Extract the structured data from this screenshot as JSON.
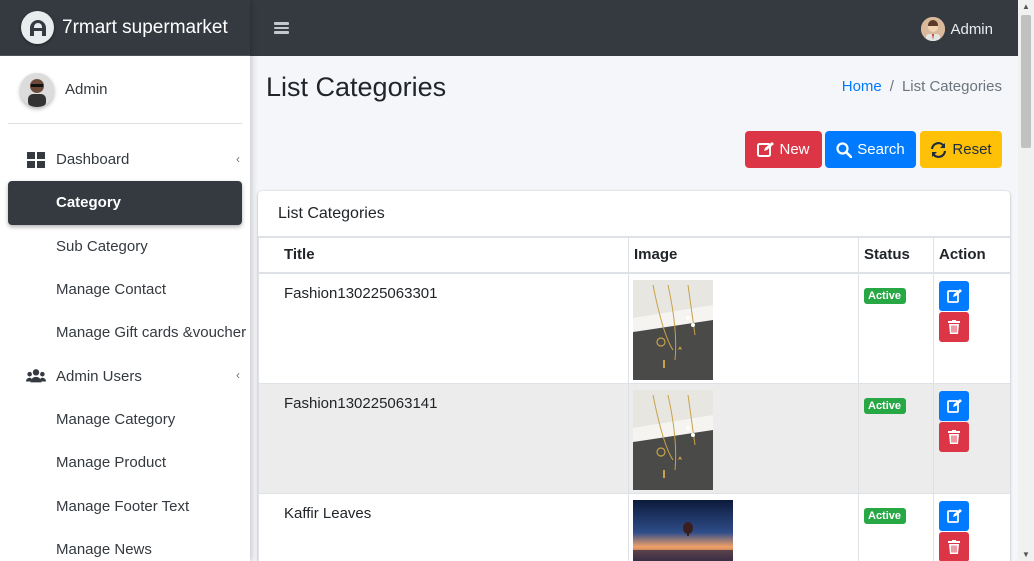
{
  "brand": {
    "name": "7rmart supermarket"
  },
  "sidebar": {
    "user_name": "Admin",
    "items": [
      {
        "label": "Dashboard"
      },
      {
        "label": "Category"
      },
      {
        "label": "Sub Category"
      },
      {
        "label": "Manage Contact"
      },
      {
        "label": "Manage Gift cards &voucher"
      },
      {
        "label": "Admin Users"
      },
      {
        "label": "Manage Category"
      },
      {
        "label": "Manage Product"
      },
      {
        "label": "Manage Footer Text"
      },
      {
        "label": "Manage News"
      }
    ]
  },
  "topbar": {
    "user_name": "Admin"
  },
  "page": {
    "title": "List Categories",
    "breadcrumb_home": "Home",
    "breadcrumb_separator": "/",
    "breadcrumb_current": "List Categories"
  },
  "toolbar": {
    "new_label": "New",
    "search_label": "Search",
    "reset_label": "Reset"
  },
  "card": {
    "header": "List Categories",
    "columns": [
      "Title",
      "Image",
      "Status",
      "Action"
    ],
    "rows": [
      {
        "title": "Fashion130225063301",
        "status": "Active"
      },
      {
        "title": "Fashion130225063141",
        "status": "Active"
      },
      {
        "title": "Kaffir Leaves",
        "status": "Active"
      }
    ]
  },
  "colors": {
    "danger": "#dc3545",
    "primary": "#007bff",
    "warning": "#ffc107",
    "success": "#28a745",
    "dark": "#343a40"
  }
}
